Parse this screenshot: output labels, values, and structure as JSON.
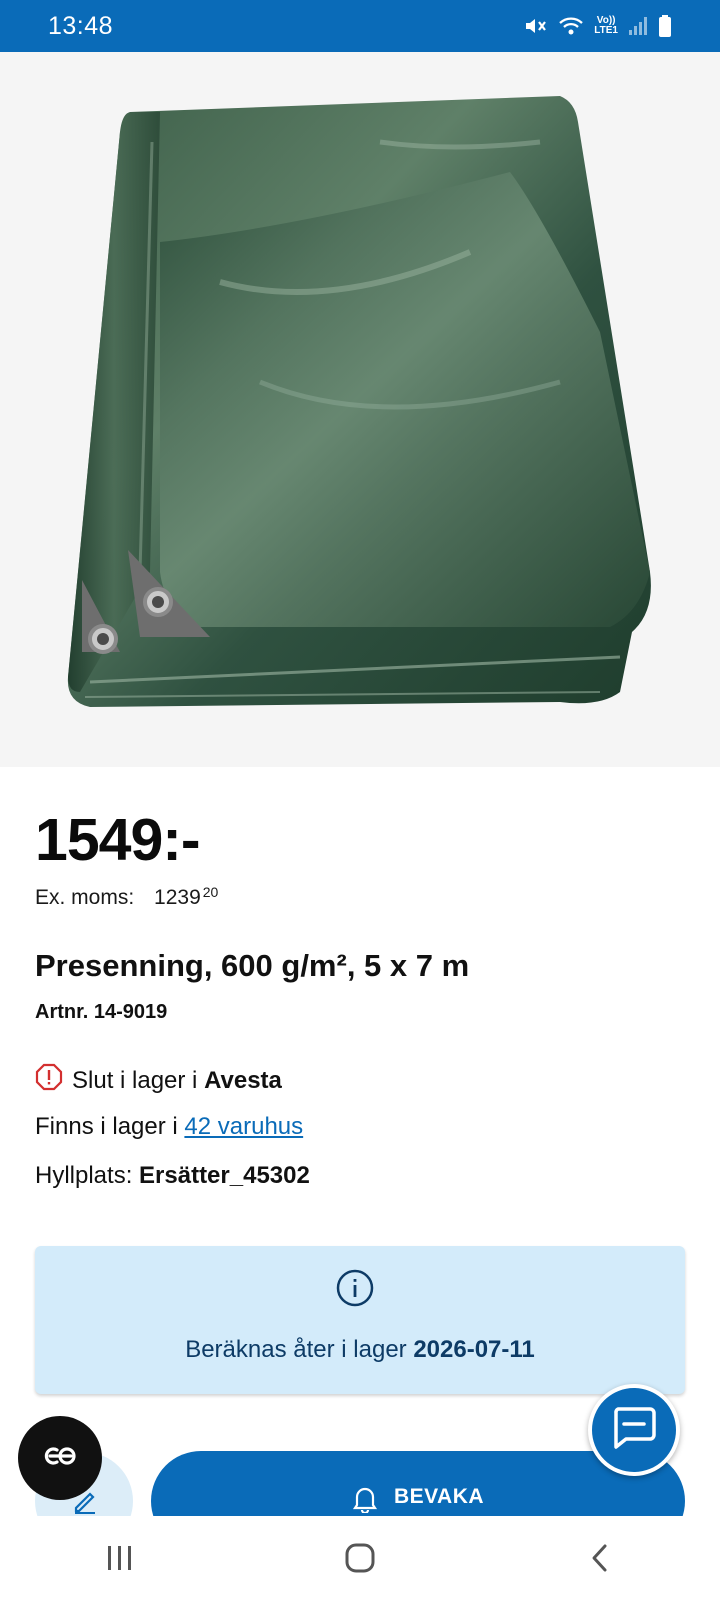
{
  "status_bar": {
    "time": "13:48",
    "network_label_top": "Vo))",
    "network_label_bottom": "LTE1",
    "icons": [
      "mute-icon",
      "wifi-icon",
      "signal-icon",
      "battery-icon"
    ]
  },
  "product": {
    "image_alt": "Presenning",
    "price": "1549:-",
    "ex_moms_label": "Ex. moms:",
    "ex_moms_main": "1239",
    "ex_moms_decimals": "20",
    "title": "Presenning, 600 g/m², 5 x 7 m",
    "artnr": "Artnr. 14-9019"
  },
  "stock": {
    "out_prefix": "Slut i lager i",
    "store": "Avesta",
    "available_prefix": "Finns i lager i",
    "available_link": "42 varuhus",
    "shelf_label": "Hyllplats:",
    "shelf_value": "Ersätter_45302"
  },
  "info_box": {
    "restock_prefix": "Beräknas åter i lager",
    "restock_date": "2026-07-11"
  },
  "actions": {
    "watch_label": "BEVAKA"
  },
  "colors": {
    "accent": "#0a6bb8",
    "info_bg": "#d3ebfa",
    "warning": "#d32f2f"
  }
}
